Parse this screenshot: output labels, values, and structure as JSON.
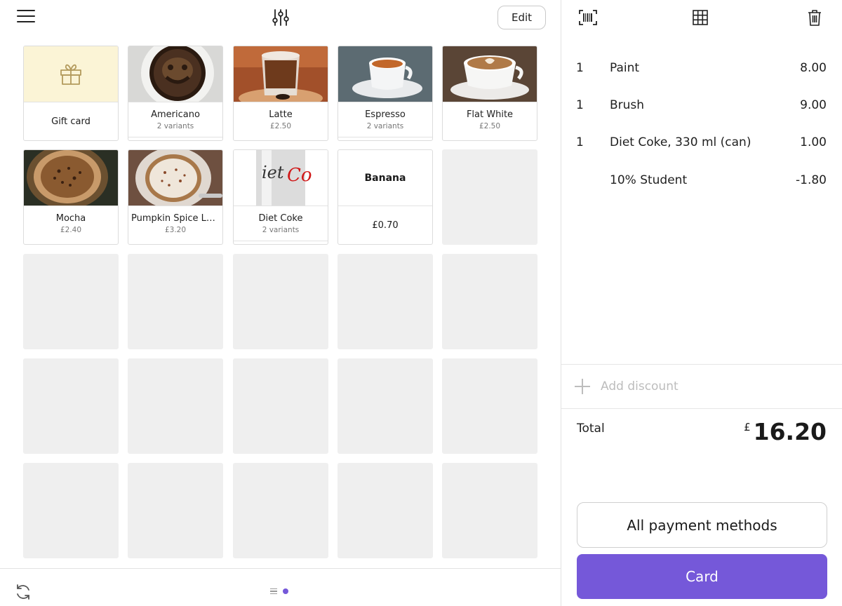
{
  "toolbar": {
    "edit_label": "Edit"
  },
  "products": [
    {
      "name": "Gift card",
      "sub": ""
    },
    {
      "name": "Americano",
      "sub": "2 variants"
    },
    {
      "name": "Latte",
      "sub": "£2.50"
    },
    {
      "name": "Espresso",
      "sub": "2 variants"
    },
    {
      "name": "Flat White",
      "sub": "£2.50"
    },
    {
      "name": "Mocha",
      "sub": "£2.40"
    },
    {
      "name": "Pumpkin Spice La...",
      "sub": "£3.20"
    },
    {
      "name": "Diet Coke",
      "sub": "2 variants"
    },
    {
      "name": "Banana",
      "sub": "£0.70"
    }
  ],
  "order": {
    "lines": [
      {
        "qty": "1",
        "item": "Paint",
        "price": "8.00"
      },
      {
        "qty": "1",
        "item": "Brush",
        "price": "9.00"
      },
      {
        "qty": "1",
        "item": "Diet Coke, 330 ml (can)",
        "price": "1.00"
      },
      {
        "qty": "",
        "item": "10% Student",
        "price": "-1.80"
      }
    ],
    "add_discount_label": "Add discount",
    "total_label": "Total",
    "currency": "£",
    "total_amount": "16.20"
  },
  "payment": {
    "all_methods_label": "All payment methods",
    "card_label": "Card"
  },
  "colors": {
    "accent": "#7558d9",
    "gift_bg": "#fbf4d6",
    "empty_tile": "#efefef"
  },
  "icons": [
    "menu-icon",
    "filter-sliders-icon",
    "barcode-icon",
    "grid-icon",
    "trash-icon",
    "sync-icon",
    "gift-icon",
    "plus-icon"
  ]
}
